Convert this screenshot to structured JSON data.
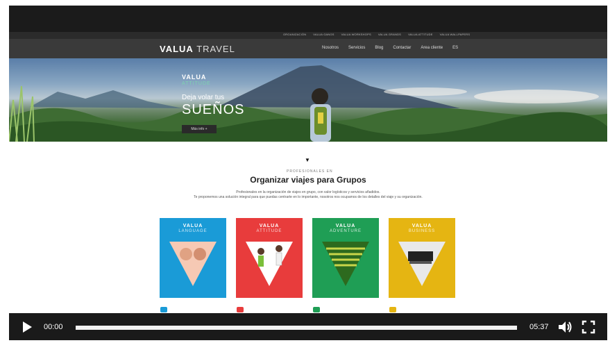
{
  "site": {
    "topbar_links": [
      "ORGANIZACIÓN",
      "VALUA GANGS",
      "VALUA WORKSHOPS",
      "VALUA GRANDS",
      "VALUA ATTITUDE",
      "VALUA WALLPAPERS"
    ],
    "logo_bold": "VALUA",
    "logo_light": "TRAVEL",
    "nav_links": [
      "Nosotros",
      "Servicios",
      "Blog",
      "Contactar",
      "Area cliente",
      "ES"
    ]
  },
  "hero": {
    "brand": "VALUA",
    "sub": "ATTITUDE",
    "line1": "Deja volar tus",
    "line2": "SUEÑOS",
    "button": "Más info +"
  },
  "section": {
    "kicker": "PROFESIONALES EN",
    "title": "Organizar viajes para Grupos",
    "desc1": "Profesionales en la organización de viajes en grupo, con valor logísticos y servicios añadidos.",
    "desc2": "Te proponemos una solución integral para que puedas centrarte en lo importante, nosotros nos ocupamos de los detalles del viaje y su organización."
  },
  "cards": [
    {
      "brand": "VALUA",
      "sub": "LANGUAGE",
      "color": "#1a9bd7"
    },
    {
      "brand": "VALUA",
      "sub": "ATTITUDE",
      "color": "#e83c3c"
    },
    {
      "brand": "VALUA",
      "sub": "ADVENTURE",
      "color": "#1f9e55"
    },
    {
      "brand": "VALUA",
      "sub": "BUSINESS",
      "color": "#e5b512"
    }
  ],
  "category_icons": [
    {
      "name": "graduation-cap-icon",
      "color": "#1a9bd7"
    },
    {
      "name": "chat-bubbles-icon",
      "color": "#e83c3c"
    },
    {
      "name": "camera-icon",
      "color": "#1f9e55"
    },
    {
      "name": "tag-icon",
      "color": "#e5b512"
    }
  ],
  "player": {
    "current_time": "00:00",
    "duration": "05:37",
    "progress_fraction": 0.0
  }
}
